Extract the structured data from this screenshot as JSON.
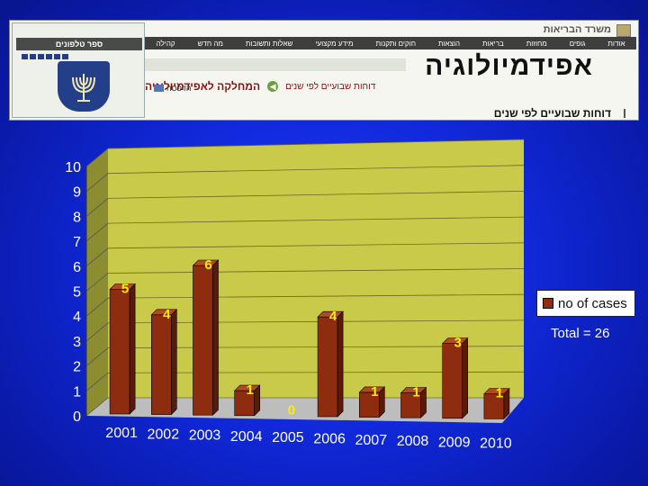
{
  "header": {
    "ministry": "משרד הבריאות",
    "phonebook": "ספר טלפונים",
    "nav_items": [
      "קהילה",
      "מה חדש",
      "שאלות ותשובות",
      "מידע מקצועי",
      "חוקים ותקנות",
      "הוצאות",
      "בריאות",
      "מחוזות",
      "גופים",
      "אודות"
    ],
    "site_title": "אפידמיולוגיה",
    "breadcrumb_main": "המחלקה לאפידמיולוגיה",
    "breadcrumb_sub": "דוחות שבועיים לפי שנים",
    "print_label": "הדפסה",
    "page_heading": "דוחות שבועיים לפי שנים",
    "colors": {
      "nav": "#3e3e3e",
      "breadcrumb": "#8b1010",
      "emblem": "#233f8a"
    }
  },
  "chart_data": {
    "type": "bar",
    "categories": [
      "2001",
      "2002",
      "2003",
      "2004",
      "2005",
      "2006",
      "2007",
      "2008",
      "2009",
      "2010"
    ],
    "series": [
      {
        "name": "no of cases",
        "values": [
          5,
          4,
          6,
          1,
          0,
          4,
          1,
          1,
          3,
          1
        ]
      }
    ],
    "data_labels": [
      "5",
      "4",
      "6",
      "1",
      "0",
      "4",
      "1",
      "1",
      "3",
      "1"
    ],
    "yticks": [
      "0",
      "1",
      "2",
      "3",
      "4",
      "5",
      "6",
      "7",
      "8",
      "9",
      "10"
    ],
    "ylim": [
      0,
      10
    ],
    "grid": true,
    "legend_position": "right",
    "annotation": "Total = 26",
    "colors": {
      "bar": "#8e2c10",
      "wall": "#c9c94a",
      "label": "#ffee00",
      "axis_text": "#ffffff"
    }
  }
}
